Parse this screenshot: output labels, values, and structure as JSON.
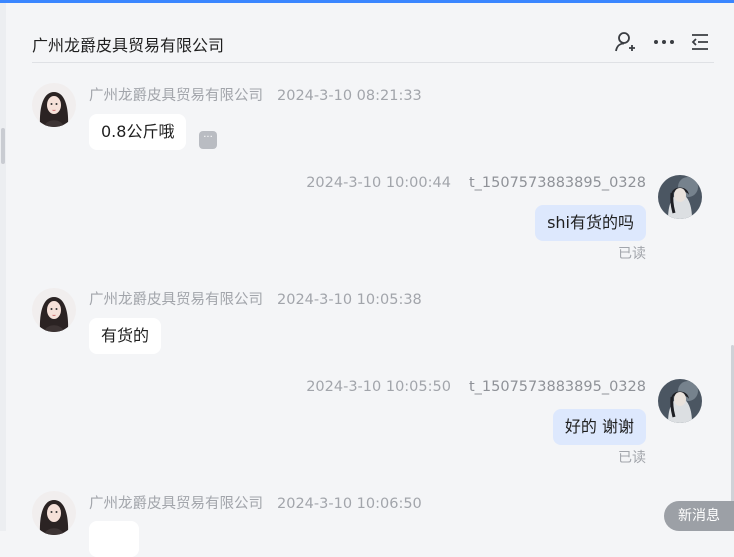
{
  "header": {
    "title": "广州龙爵皮具贸易有限公司",
    "icons": [
      "add-user-icon",
      "more-icon",
      "list-icon"
    ]
  },
  "messages": [
    {
      "direction": "in",
      "sender": "广州龙爵皮具贸易有限公司",
      "time": "2024-3-10 08:21:33",
      "text": "0.8公斤哦"
    },
    {
      "direction": "out",
      "sender": "t_1507573883895_0328",
      "time": "2024-3-10 10:00:44",
      "text": "shi有货的吗",
      "status": "已读"
    },
    {
      "direction": "in",
      "sender": "广州龙爵皮具贸易有限公司",
      "time": "2024-3-10 10:05:38",
      "text": "有货的"
    },
    {
      "direction": "out",
      "sender": "t_1507573883895_0328",
      "time": "2024-3-10 10:05:50",
      "text": "好的 谢谢",
      "status": "已读"
    },
    {
      "direction": "in",
      "sender": "广州龙爵皮具贸易有限公司",
      "time": "2024-3-10 10:06:50",
      "text": ""
    }
  ],
  "more_badge": "···",
  "new_message_button": "新消息",
  "colors": {
    "accent": "#3a86ff",
    "outgoing_bubble": "#dde8fd",
    "incoming_bubble": "#ffffff"
  }
}
